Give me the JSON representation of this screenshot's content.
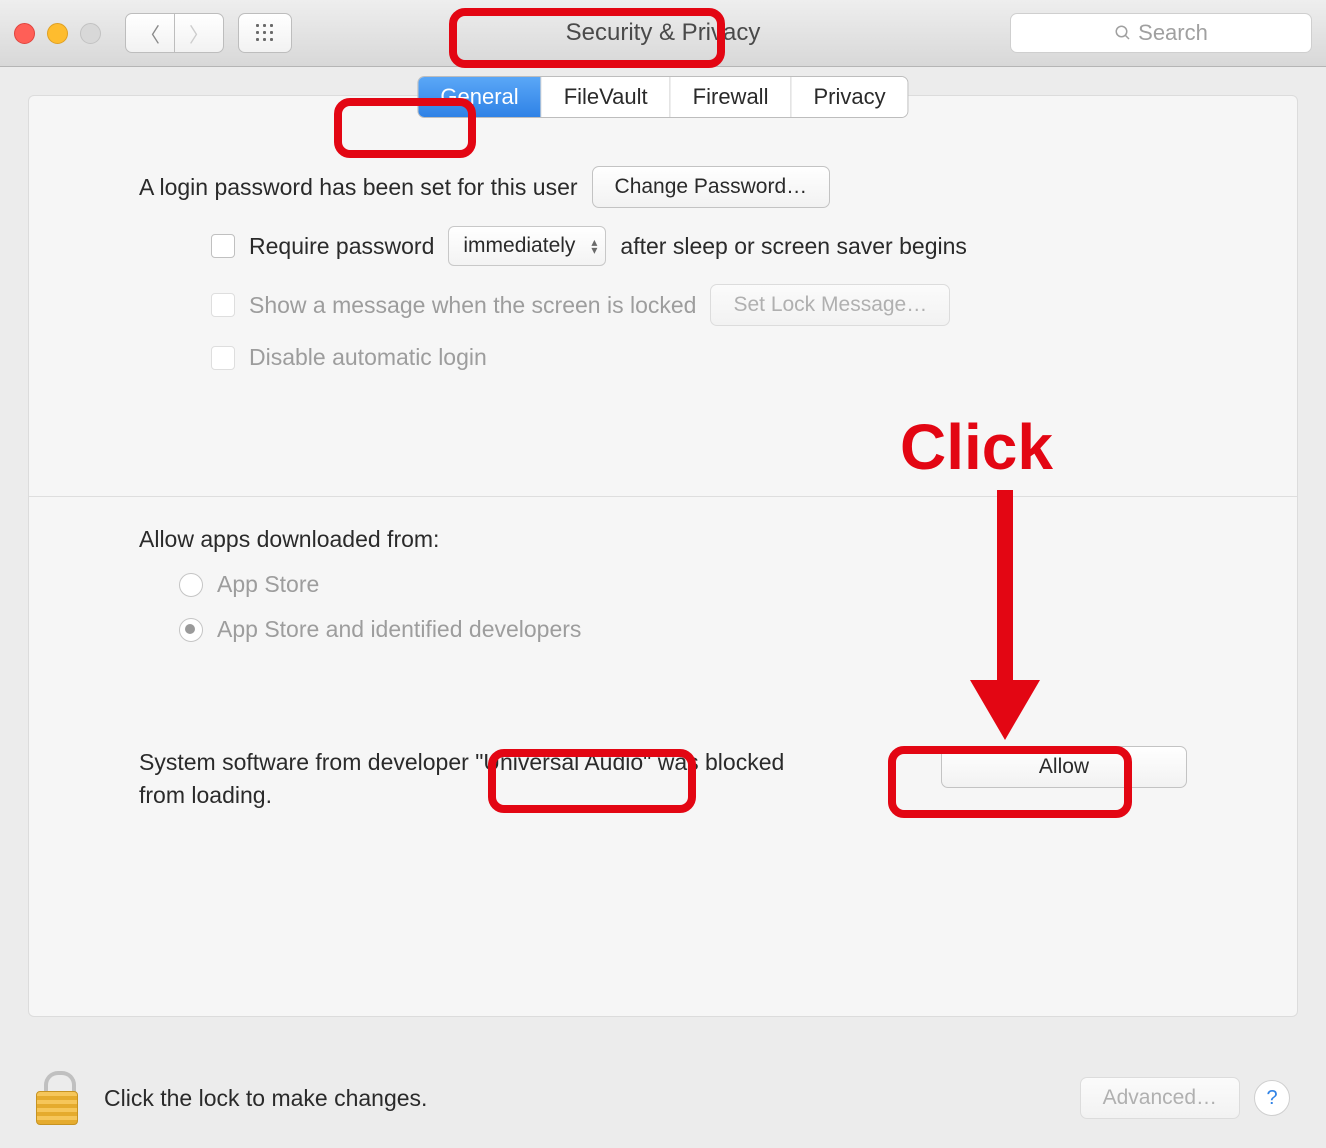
{
  "toolbar": {
    "title": "Security & Privacy",
    "search_placeholder": "Search"
  },
  "tabs": {
    "general": "General",
    "filevault": "FileVault",
    "firewall": "Firewall",
    "privacy": "Privacy"
  },
  "login": {
    "password_set_text": "A login password has been set for this user",
    "change_password_btn": "Change Password…",
    "require_password_label": "Require password",
    "require_password_delay": "immediately",
    "require_password_suffix": "after sleep or screen saver begins",
    "show_message_label": "Show a message when the screen is locked",
    "set_lock_message_btn": "Set Lock Message…",
    "disable_auto_login_label": "Disable automatic login"
  },
  "allow_apps": {
    "heading": "Allow apps downloaded from:",
    "opt_app_store": "App Store",
    "opt_identified": "App Store and identified developers"
  },
  "blocked": {
    "prefix": "System software from developer ",
    "developer": "\"Universal Audio\"",
    "suffix": " was blocked from loading.",
    "allow_btn": "Allow"
  },
  "footer": {
    "lock_text": "Click the lock to make changes.",
    "advanced_btn": "Advanced…"
  },
  "annotation": {
    "click_label": "Click"
  }
}
